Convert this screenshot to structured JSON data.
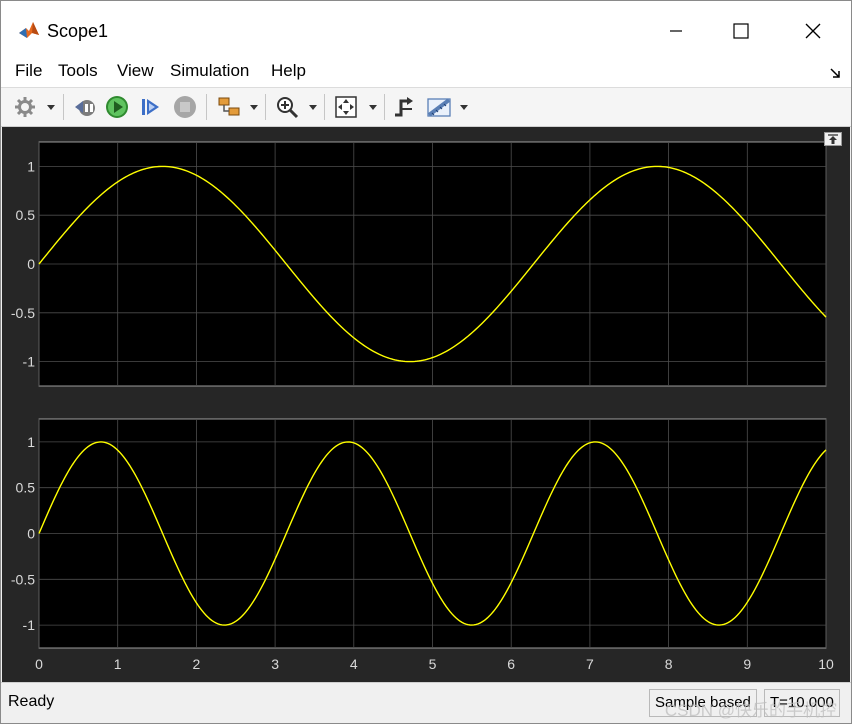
{
  "window": {
    "title": "Scope1"
  },
  "menu": {
    "items": [
      "File",
      "Tools",
      "View",
      "Simulation",
      "Help"
    ]
  },
  "toolbar": {
    "buttons": [
      "settings-icon",
      "step-back-icon",
      "run-icon",
      "step-forward-icon",
      "stop-icon",
      "highlight-block-icon",
      "zoom-in-icon",
      "fit-to-view-icon",
      "triggers-icon",
      "measurements-icon"
    ]
  },
  "colors": {
    "plot_bg": "#000000",
    "figure_bg": "#262626",
    "signal": "#ffff00",
    "grid": "#4d4d4d",
    "tick_text": "#d9d9d9"
  },
  "chart_data": [
    {
      "type": "line",
      "xlim": [
        0,
        10
      ],
      "ylim": [
        -1.25,
        1.25
      ],
      "yticks": [
        -1,
        -0.5,
        0,
        0.5,
        1
      ],
      "ytick_labels": [
        "-1",
        "-0.5",
        "0",
        "0.5",
        "1"
      ],
      "grid": true,
      "series": [
        {
          "function": "sin(t)",
          "x": [
            0,
            1.571,
            3.142,
            4.712,
            6.283,
            7.854,
            9.425,
            10
          ],
          "y": [
            0,
            1,
            0,
            -1,
            0,
            1,
            0,
            -0.544
          ]
        }
      ]
    },
    {
      "type": "line",
      "xlim": [
        0,
        10
      ],
      "ylim": [
        -1.25,
        1.25
      ],
      "xticks": [
        0,
        1,
        2,
        3,
        4,
        5,
        6,
        7,
        8,
        9,
        10
      ],
      "xtick_labels": [
        "0",
        "1",
        "2",
        "3",
        "4",
        "5",
        "6",
        "7",
        "8",
        "9",
        "10"
      ],
      "yticks": [
        -1,
        -0.5,
        0,
        0.5,
        1
      ],
      "ytick_labels": [
        "-1",
        "-0.5",
        "0",
        "0.5",
        "1"
      ],
      "grid": true,
      "series": [
        {
          "function": "sin(2t)",
          "x": [
            0,
            0.785,
            1.571,
            2.356,
            3.142,
            3.927,
            4.712,
            5.498,
            6.283,
            7.069,
            7.854,
            8.639,
            9.425,
            10
          ],
          "y": [
            0,
            1,
            0,
            -1,
            0,
            1,
            0,
            -1,
            0,
            1,
            0,
            -1,
            0,
            0.913
          ]
        }
      ]
    }
  ],
  "status": {
    "text": "Ready",
    "sample_mode": "Sample based",
    "time": "T=10.000",
    "watermark": "CSDN @快乐的手机控"
  }
}
